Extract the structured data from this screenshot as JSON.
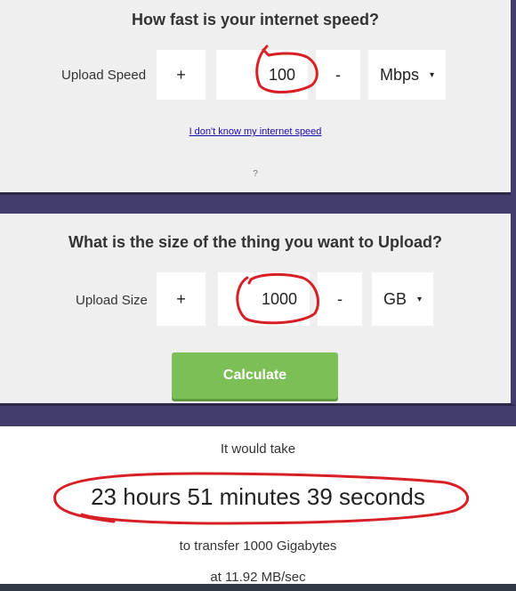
{
  "speed": {
    "title": "How fast is your internet speed?",
    "label": "Upload Speed",
    "plus": "+",
    "value": "100",
    "minus": "-",
    "unit": "Mbps",
    "unit_arrow": "▾",
    "link": "I don't know my internet speed",
    "question": "?"
  },
  "size": {
    "title": "What is the size of the thing you want to Upload?",
    "label": "Upload Size",
    "plus": "+",
    "value": "1000",
    "minus": "-",
    "unit": "GB",
    "unit_arrow": "▾",
    "calculate": "Calculate"
  },
  "result": {
    "intro": "It would take",
    "duration": "23 hours 51 minutes 39 seconds",
    "transfer": "to transfer 1000 Gigabytes",
    "rate": "at 11.92 MB/sec"
  },
  "colors": {
    "accent_button": "#7dbf57",
    "annotation": "#d81f26",
    "background": "#433d6b"
  }
}
